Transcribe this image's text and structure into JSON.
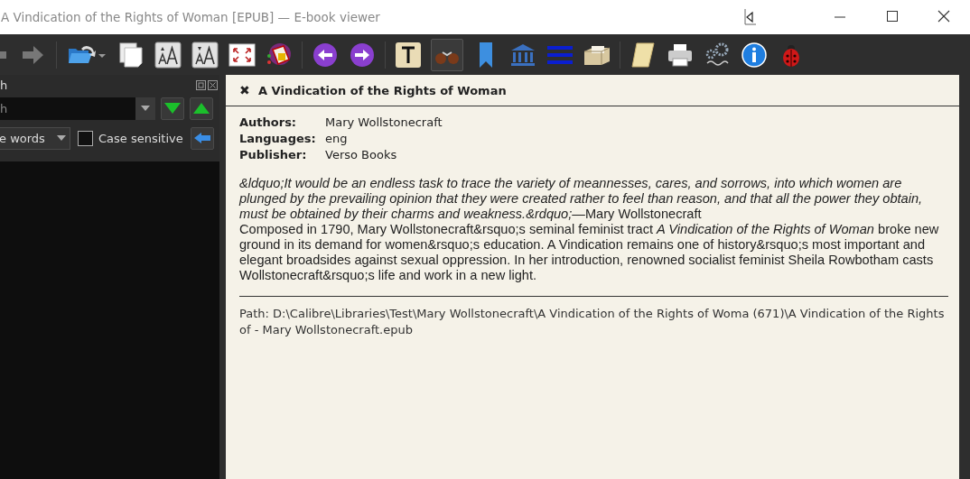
{
  "window": {
    "title": "A Vindication of the Rights of Woman [EPUB] — E-book viewer"
  },
  "toolbar": {
    "lookup_active": true
  },
  "search_panel": {
    "title": "h",
    "placeholder": "h",
    "mode": "e words",
    "case_sensitive": {
      "label": "Case sensitive",
      "checked": false
    }
  },
  "book": {
    "close": "✖",
    "title": "A Vindication of the Rights of Woman",
    "metadata": [
      {
        "label": "Authors:",
        "value": "Mary Wollstonecraft"
      },
      {
        "label": "Languages:",
        "value": "eng"
      },
      {
        "label": "Publisher:",
        "value": "Verso Books"
      }
    ],
    "quote": "*&ldquo;It would be an endless task to trace the variety of meannesses, cares, and sorrows, into which women are plunged by the prevailing opinion that they were created rather to feel than reason, and that all the power they obtain, must be obtained by their charms and weakness.&rdquo;*—Mary Wollstonecraft",
    "description": "Composed in 1790, Mary Wollstonecraft&rsquo;s seminal feminist tract *A Vindication of the Rights of Woman* broke new ground in its demand for women&rsquo;s education. A Vindication remains one of history&rsquo;s most important and elegant broadsides against sexual oppression. In her introduction, renowned socialist feminist Sheila Rowbotham casts Wollstonecraft&rsquo;s life and work in a new light.",
    "path": "Path: D:\\Calibre\\Libraries\\Test\\Mary Wollstonecraft\\A Vindication of the Rights of Woma (671)\\A Vindication of the Rights of - Mary Wollstonecraft.epub"
  }
}
